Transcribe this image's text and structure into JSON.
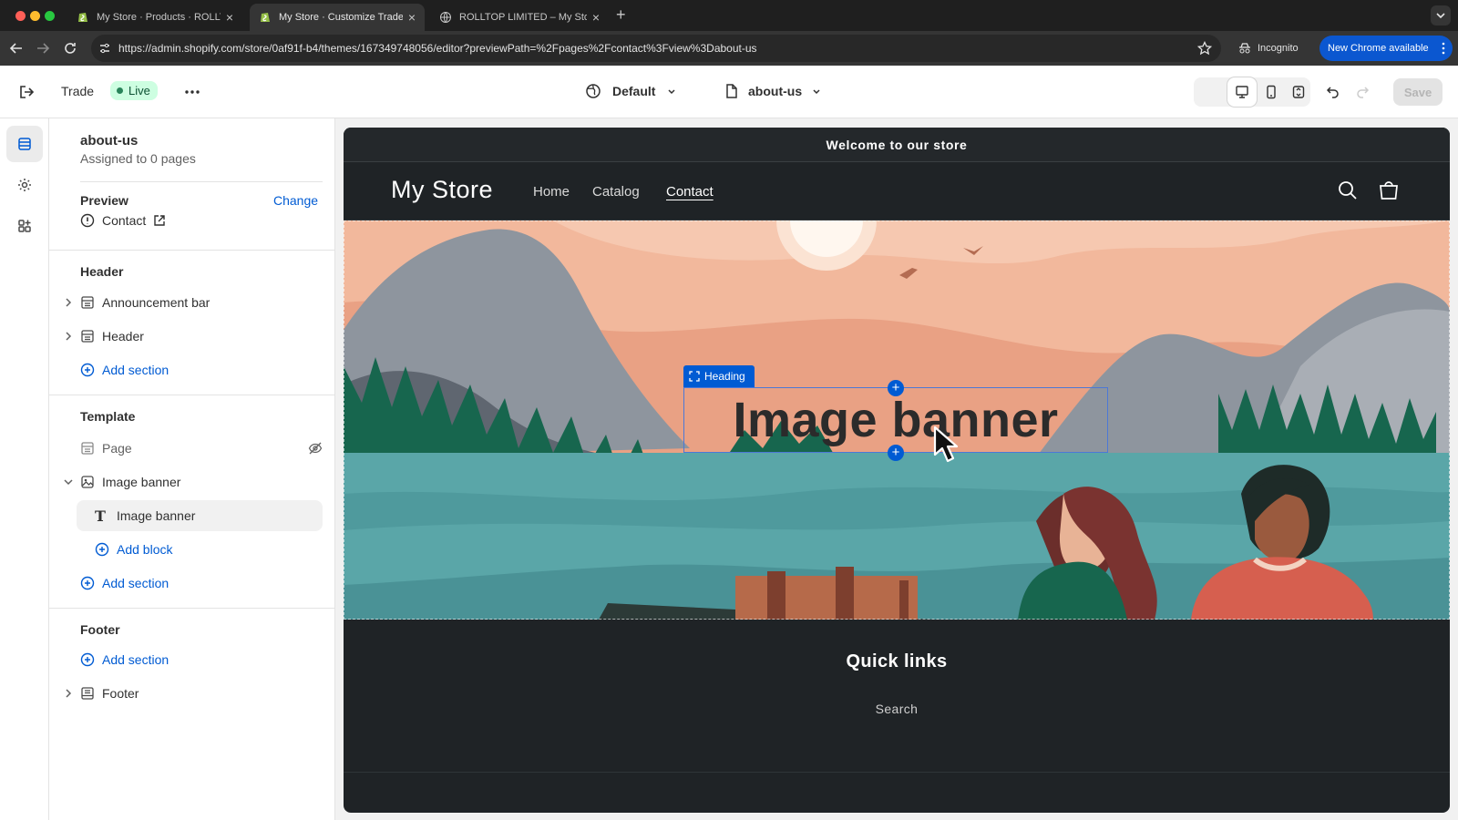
{
  "browser": {
    "tabs": [
      {
        "title": "My Store · Products · ROLLTO",
        "active": false
      },
      {
        "title": "My Store · Customize Trade ·",
        "active": true
      },
      {
        "title": "ROLLTOP LIMITED – My Store",
        "active": false
      }
    ],
    "url": "https://admin.shopify.com/store/0af91f-b4/themes/167349748056/editor?previewPath=%2Fpages%2Fcontact%3Fview%3Dabout-us",
    "incognito_label": "Incognito",
    "new_chrome_label": "New Chrome available"
  },
  "editor": {
    "theme_name": "Trade",
    "status": "Live",
    "context_selector": "Default",
    "template_selector": "about-us",
    "save_label": "Save"
  },
  "sidebar": {
    "template_title": "about-us",
    "assigned": "Assigned to 0 pages",
    "preview_label": "Preview",
    "change_label": "Change",
    "preview_page": "Contact",
    "header_group": {
      "title": "Header",
      "items": [
        "Announcement bar",
        "Header"
      ],
      "add_section": "Add section"
    },
    "template_group": {
      "title": "Template",
      "page_item": "Page",
      "section": "Image banner",
      "block": "Image banner",
      "add_block": "Add block",
      "add_section": "Add section"
    },
    "footer_group": {
      "title": "Footer",
      "add_section": "Add section",
      "item": "Footer"
    }
  },
  "preview": {
    "announcement": "Welcome to our store",
    "store_name": "My Store",
    "nav": [
      "Home",
      "Catalog",
      "Contact"
    ],
    "active_nav": "Contact",
    "heading_tag": "Heading",
    "banner_heading": "Image banner",
    "footer_title": "Quick links",
    "footer_link": "Search"
  },
  "colors": {
    "accent": "#005bd3",
    "live_badge_bg": "#cdfee1",
    "store_bg": "#1f2326"
  }
}
